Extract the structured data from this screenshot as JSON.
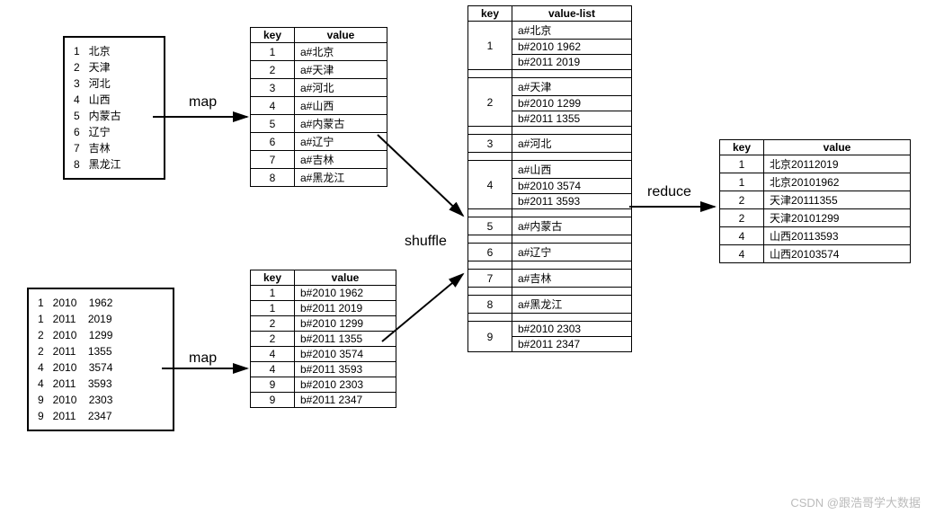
{
  "labels": {
    "map1": "map",
    "map2": "map",
    "shuffle": "shuffle",
    "reduce": "reduce"
  },
  "headers": {
    "key": "key",
    "value": "value",
    "valuelist": "value-list"
  },
  "input_a": [
    {
      "k": "1",
      "v": "北京"
    },
    {
      "k": "2",
      "v": "天津"
    },
    {
      "k": "3",
      "v": "河北"
    },
    {
      "k": "4",
      "v": "山西"
    },
    {
      "k": "5",
      "v": "内蒙古"
    },
    {
      "k": "6",
      "v": "辽宁"
    },
    {
      "k": "7",
      "v": "吉林"
    },
    {
      "k": "8",
      "v": "黑龙江"
    }
  ],
  "input_b": [
    {
      "k": "1",
      "y": "2010",
      "v": "1962"
    },
    {
      "k": "1",
      "y": "2011",
      "v": "2019"
    },
    {
      "k": "2",
      "y": "2010",
      "v": "1299"
    },
    {
      "k": "2",
      "y": "2011",
      "v": "1355"
    },
    {
      "k": "4",
      "y": "2010",
      "v": "3574"
    },
    {
      "k": "4",
      "y": "2011",
      "v": "3593"
    },
    {
      "k": "9",
      "y": "2010",
      "v": "2303"
    },
    {
      "k": "9",
      "y": "2011",
      "v": "2347"
    }
  ],
  "map_a": [
    {
      "k": "1",
      "v": "a#北京"
    },
    {
      "k": "2",
      "v": "a#天津"
    },
    {
      "k": "3",
      "v": "a#河北"
    },
    {
      "k": "4",
      "v": "a#山西"
    },
    {
      "k": "5",
      "v": "a#内蒙古"
    },
    {
      "k": "6",
      "v": "a#辽宁"
    },
    {
      "k": "7",
      "v": "a#吉林"
    },
    {
      "k": "8",
      "v": "a#黑龙江"
    }
  ],
  "map_b": [
    {
      "k": "1",
      "v": "b#2010 1962"
    },
    {
      "k": "1",
      "v": "b#2011 2019"
    },
    {
      "k": "2",
      "v": "b#2010 1299"
    },
    {
      "k": "2",
      "v": "b#2011 1355"
    },
    {
      "k": "4",
      "v": "b#2010 3574"
    },
    {
      "k": "4",
      "v": "b#2011 3593"
    },
    {
      "k": "9",
      "v": "b#2010 2303"
    },
    {
      "k": "9",
      "v": "b#2011 2347"
    }
  ],
  "shuffle_groups": [
    {
      "k": "1",
      "vals": [
        "a#北京",
        "b#2010 1962",
        "b#2011 2019"
      ]
    },
    {
      "k": "2",
      "vals": [
        "a#天津",
        "b#2010 1299",
        "b#2011 1355"
      ]
    },
    {
      "k": "3",
      "vals": [
        "a#河北"
      ]
    },
    {
      "k": "4",
      "vals": [
        "a#山西",
        "b#2010 3574",
        "b#2011 3593"
      ]
    },
    {
      "k": "5",
      "vals": [
        "a#内蒙古"
      ]
    },
    {
      "k": "6",
      "vals": [
        "a#辽宁"
      ]
    },
    {
      "k": "7",
      "vals": [
        "a#吉林"
      ]
    },
    {
      "k": "8",
      "vals": [
        "a#黑龙江"
      ]
    },
    {
      "k": "9",
      "vals": [
        "b#2010 2303",
        "b#2011 2347"
      ]
    }
  ],
  "reduce_out": [
    {
      "k": "1",
      "n": "北京",
      "y": "2011",
      "v": "2019"
    },
    {
      "k": "1",
      "n": "北京",
      "y": "2010",
      "v": "1962"
    },
    {
      "k": "2",
      "n": "天津",
      "y": "2011",
      "v": "1355"
    },
    {
      "k": "2",
      "n": "天津",
      "y": "2010",
      "v": "1299"
    },
    {
      "k": "4",
      "n": "山西",
      "y": "2011",
      "v": "3593"
    },
    {
      "k": "4",
      "n": "山西",
      "y": "2010",
      "v": "3574"
    }
  ],
  "watermark": "CSDN @跟浩哥学大数据"
}
